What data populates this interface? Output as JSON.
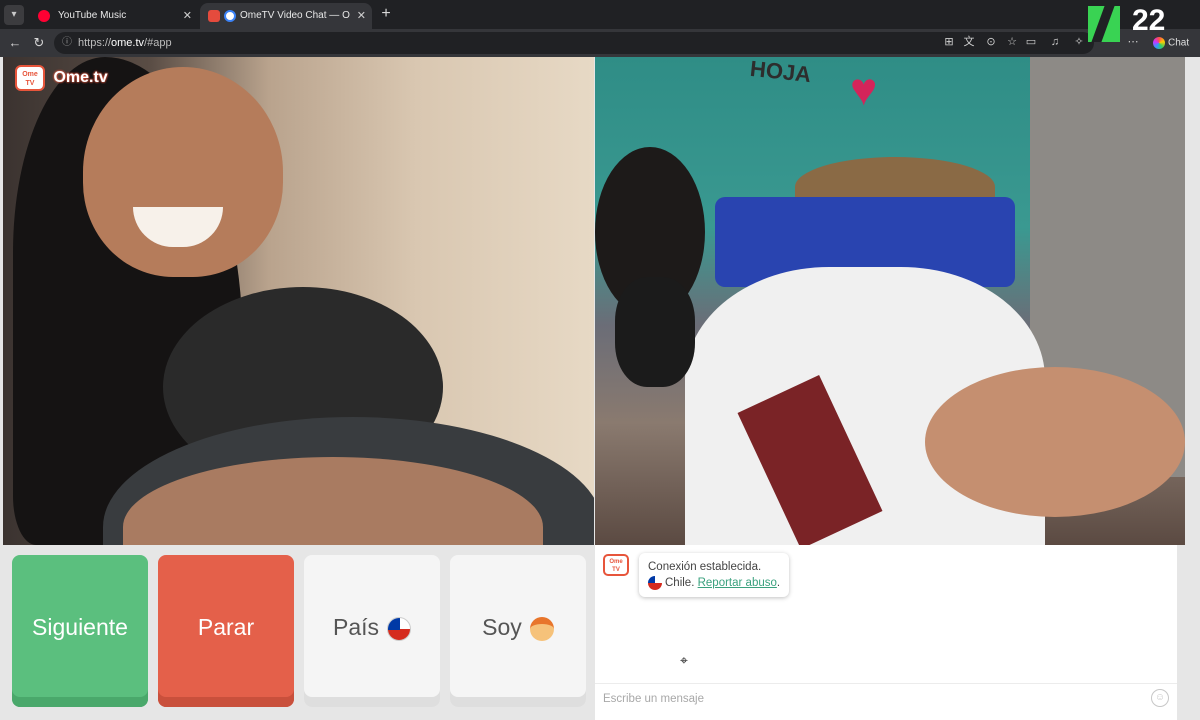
{
  "browser": {
    "tabs": [
      {
        "title": "YouTube Music",
        "favicon_color": "#ff0033"
      },
      {
        "title": "OmeTV Video Chat — Omegl",
        "favicon_color": "#3b82f6"
      }
    ],
    "url_prefix": "https://",
    "url_host": "ome.tv",
    "url_path": "/#app"
  },
  "stream_overlay": {
    "viewer_count": "22",
    "chat_label": "Chat"
  },
  "logo": {
    "icon_text": "Ome TV",
    "brand": "Ome.tv"
  },
  "remote_video": {
    "graffiti": "HOJA"
  },
  "controls": {
    "next_label": "Siguiente",
    "stop_label": "Parar",
    "country_label": "País",
    "gender_label": "Soy"
  },
  "chat": {
    "system_message": "Conexión establecida.",
    "country": "Chile.",
    "report_label": "Reportar abuso",
    "report_suffix": ".",
    "input_placeholder": "Escribe un mensaje"
  },
  "colors": {
    "next": "#5bbf7e",
    "stop": "#e4604a",
    "brand": "#e7553b",
    "link": "#3aa17e"
  }
}
